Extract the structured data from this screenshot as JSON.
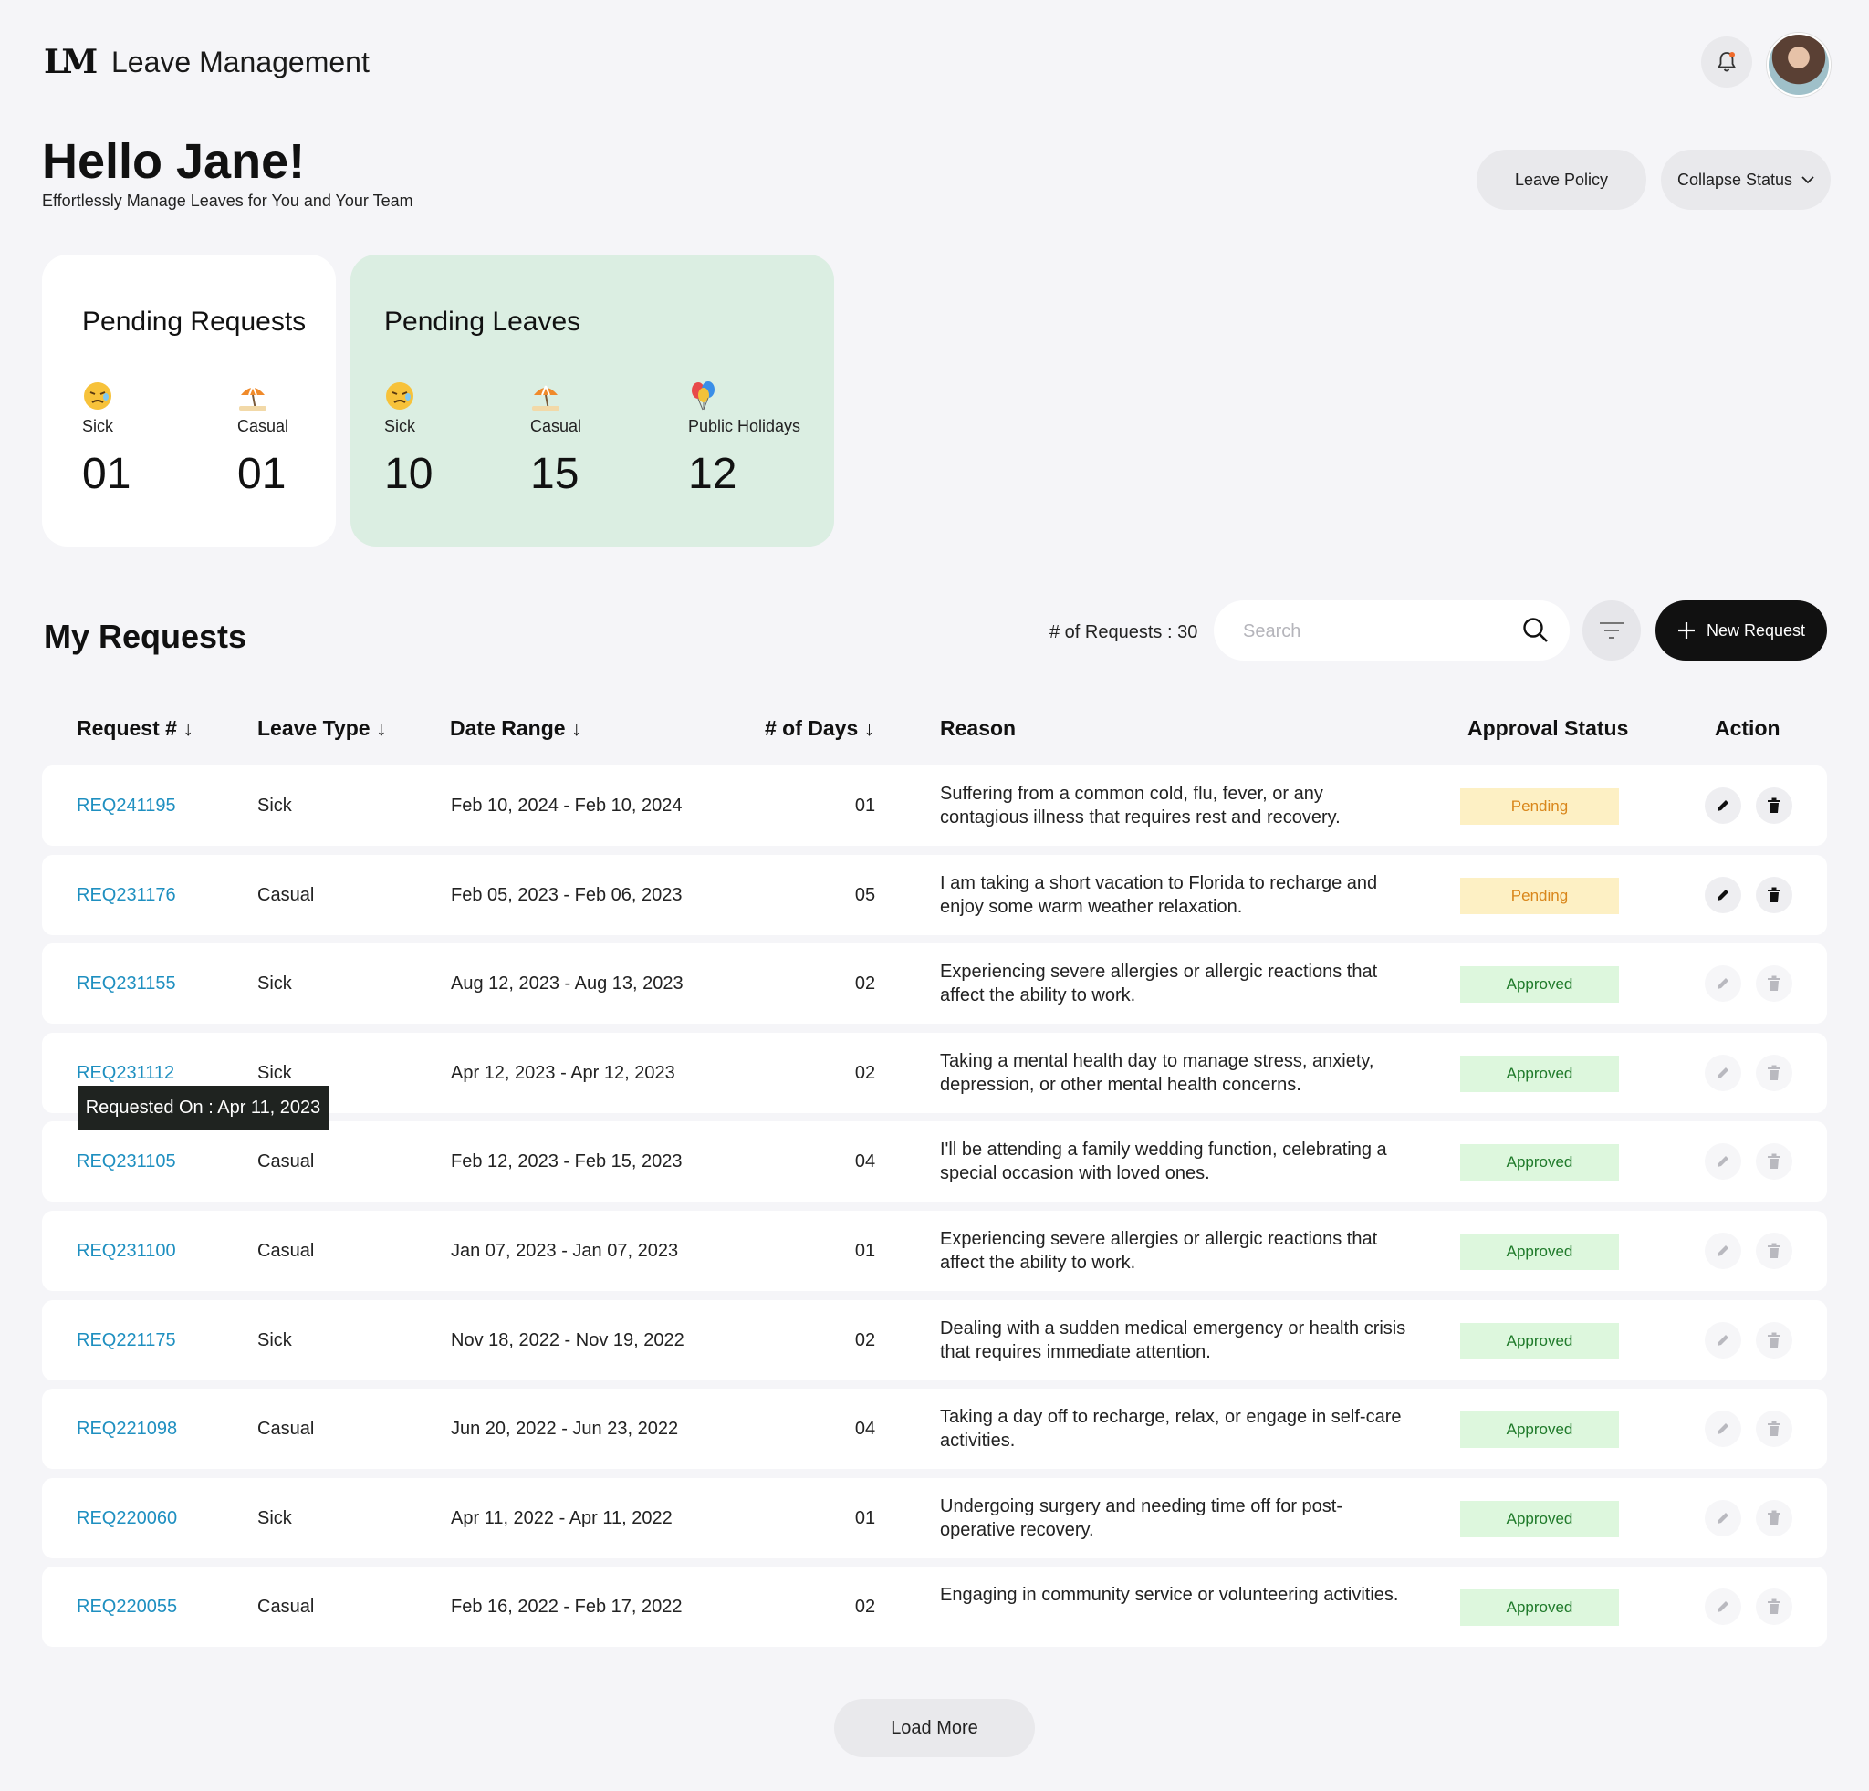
{
  "header": {
    "logo_text": "LM",
    "app_title": "Leave Management",
    "bell_icon": "bell-icon",
    "avatar_icon": "user-avatar"
  },
  "greeting": {
    "title": "Hello Jane!",
    "subtitle": "Effortlessly Manage Leaves for You and Your Team"
  },
  "top_actions": {
    "leave_policy_label": "Leave Policy",
    "collapse_status_label": "Collapse Status"
  },
  "pending_requests": {
    "title": "Pending Requests",
    "stats": [
      {
        "label": "Sick",
        "value": "01",
        "icon": "sick-face-emoji"
      },
      {
        "label": "Casual",
        "value": "01",
        "icon": "beach-umbrella-emoji"
      }
    ]
  },
  "pending_leaves": {
    "title": "Pending Leaves",
    "stats": [
      {
        "label": "Sick",
        "value": "10",
        "icon": "sick-face-emoji"
      },
      {
        "label": "Casual",
        "value": "15",
        "icon": "beach-umbrella-emoji"
      },
      {
        "label": "Public Holidays",
        "value": "12",
        "icon": "balloons-emoji"
      }
    ]
  },
  "requests": {
    "title": "My Requests",
    "count_text": "# of Requests : 30",
    "search_placeholder": "Search",
    "new_request_label": "New Request",
    "columns": {
      "request": "Request # ↓",
      "leave_type": "Leave Type ↓",
      "date_range": "Date Range ↓",
      "days": "# of Days ↓",
      "reason": "Reason",
      "status": "Approval Status",
      "action": "Action"
    },
    "rows": [
      {
        "id": "REQ241195",
        "type": "Sick",
        "range": "Feb 10, 2024 - Feb 10, 2024",
        "days": "01",
        "reason": "Suffering from a common cold, flu, fever, or any contagious illness that requires rest and recovery.",
        "status": "Pending"
      },
      {
        "id": "REQ231176",
        "type": "Casual",
        "range": "Feb 05, 2023 - Feb 06, 2023",
        "days": "05",
        "reason": "I am taking a short vacation to Florida to recharge and enjoy some warm weather relaxation.",
        "status": "Pending"
      },
      {
        "id": "REQ231155",
        "type": "Sick",
        "range": "Aug 12, 2023 - Aug 13, 2023",
        "days": "02",
        "reason": "Experiencing severe allergies or allergic reactions that affect the ability to work.",
        "status": "Approved"
      },
      {
        "id": "REQ231112",
        "type": "Sick",
        "range": "Apr 12, 2023 - Apr 12, 2023",
        "days": "02",
        "reason": "Taking a mental health day to manage stress, anxiety, depression, or other mental health concerns.",
        "status": "Approved"
      },
      {
        "id": "REQ231105",
        "type": "Casual",
        "range": "Feb 12, 2023 - Feb 15, 2023",
        "days": "04",
        "reason": "I'll be attending a family wedding function, celebrating a special occasion with loved ones.",
        "status": "Approved"
      },
      {
        "id": "REQ231100",
        "type": "Casual",
        "range": "Jan 07, 2023 - Jan 07, 2023",
        "days": "01",
        "reason": "Experiencing severe allergies or allergic reactions that affect the ability to work.",
        "status": "Approved"
      },
      {
        "id": "REQ221175",
        "type": "Sick",
        "range": "Nov 18, 2022 - Nov 19, 2022",
        "days": "02",
        "reason": "Dealing with a sudden medical emergency or health crisis that requires immediate attention.",
        "status": "Approved"
      },
      {
        "id": "REQ221098",
        "type": "Casual",
        "range": "Jun 20, 2022 - Jun 23, 2022",
        "days": "04",
        "reason": "Taking a day off to recharge, relax, or engage in self-care activities.",
        "status": "Approved"
      },
      {
        "id": "REQ220060",
        "type": "Sick",
        "range": "Apr 11, 2022 - Apr 11, 2022",
        "days": "01",
        "reason": "Undergoing surgery and needing time off for post-operative recovery.",
        "status": "Approved"
      },
      {
        "id": "REQ220055",
        "type": "Casual",
        "range": "Feb 16, 2022 - Feb 17, 2022",
        "days": "02",
        "reason": "Engaging in community service or volunteering activities.",
        "status": "Approved"
      }
    ],
    "tooltip": "Requested On : Apr 11, 2023",
    "load_more_label": "Load More"
  },
  "colors": {
    "link": "#1e8fc0",
    "pending_bg": "#fdf0c4",
    "pending_text": "#d9861a",
    "approved_bg": "#ddf7dd",
    "approved_text": "#1f7a2a",
    "leaves_card_bg": "#dbeee2"
  }
}
